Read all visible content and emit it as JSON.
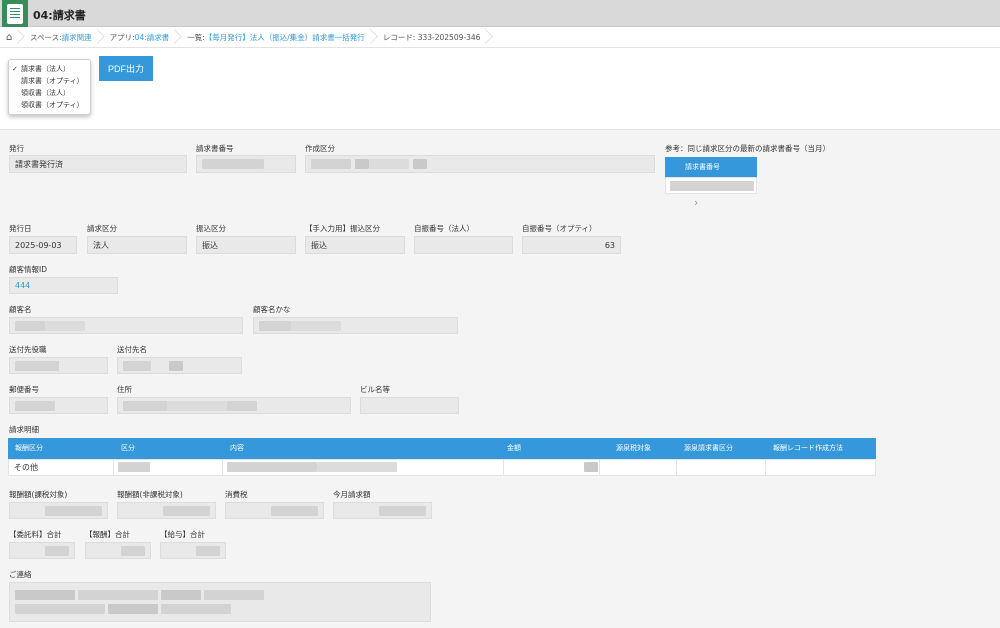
{
  "header": {
    "title": "04:請求書"
  },
  "breadcrumb": {
    "home_icon": "home-icon",
    "items": [
      {
        "prefix": "スペース: ",
        "link": "請求関連"
      },
      {
        "prefix": "アプリ: ",
        "link": "04:請求書"
      },
      {
        "prefix": "一覧: ",
        "link": "【毎月発行】法人（振込/集金）請求書一括発行"
      },
      {
        "prefix": "",
        "link": "",
        "text": "レコード: 333-202509-346"
      }
    ]
  },
  "toolbar": {
    "dropdown_options": [
      "請求書（法人）",
      "請求書（オプティ）",
      "領収書（法人）",
      "領収書（オプティ）"
    ],
    "selected_index": 0,
    "pdf_button": "PDF出力"
  },
  "form": {
    "issue": {
      "label": "発行",
      "value": "請求書発行済"
    },
    "invoice_no": {
      "label": "請求書番号"
    },
    "creation_type": {
      "label": "作成区分"
    },
    "reference": {
      "label": "参考：同じ請求区分の最新の請求書番号（当月）",
      "column": "請求書番号",
      "next_icon": "chevron-right-icon"
    },
    "issue_date": {
      "label": "発行日",
      "value": "2025-09-03"
    },
    "billing_type": {
      "label": "請求区分",
      "value": "法人"
    },
    "transfer_type": {
      "label": "振込区分",
      "value": "振込"
    },
    "manual_transfer_type": {
      "label": "【手入力用】振込区分",
      "value": "振込"
    },
    "auto_no_corp": {
      "label": "自振番号（法人）",
      "value": ""
    },
    "auto_no_opti": {
      "label": "自振番号（オプティ）",
      "value": "63"
    },
    "customer_id": {
      "label": "顧客情報ID",
      "value": "444"
    },
    "customer_name": {
      "label": "顧客名"
    },
    "customer_kana": {
      "label": "顧客名かな"
    },
    "send_title": {
      "label": "送付先役職"
    },
    "send_name": {
      "label": "送付先名"
    },
    "postal": {
      "label": "郵便番号"
    },
    "address": {
      "label": "住所"
    },
    "building": {
      "label": "ビル名等",
      "value": ""
    },
    "details_title": "請求明細",
    "details_columns": [
      "報酬区分",
      "区分",
      "内容",
      "金額",
      "源泉税対象",
      "源泉請求書区分",
      "報酬レコード作成方法"
    ],
    "details_rows": [
      {
        "type": "その他"
      }
    ],
    "fee_taxable": {
      "label": "報酬額(課税対象)"
    },
    "fee_nontaxable": {
      "label": "報酬額(非課税対象)"
    },
    "consumption_tax": {
      "label": "消費税"
    },
    "monthly_total": {
      "label": "今月請求額"
    },
    "commission_total": {
      "label": "【委託料】合計"
    },
    "fee_total": {
      "label": "【報酬】合計"
    },
    "salary_total": {
      "label": "【給与】合計"
    },
    "contact": {
      "label": "ご連絡"
    }
  }
}
